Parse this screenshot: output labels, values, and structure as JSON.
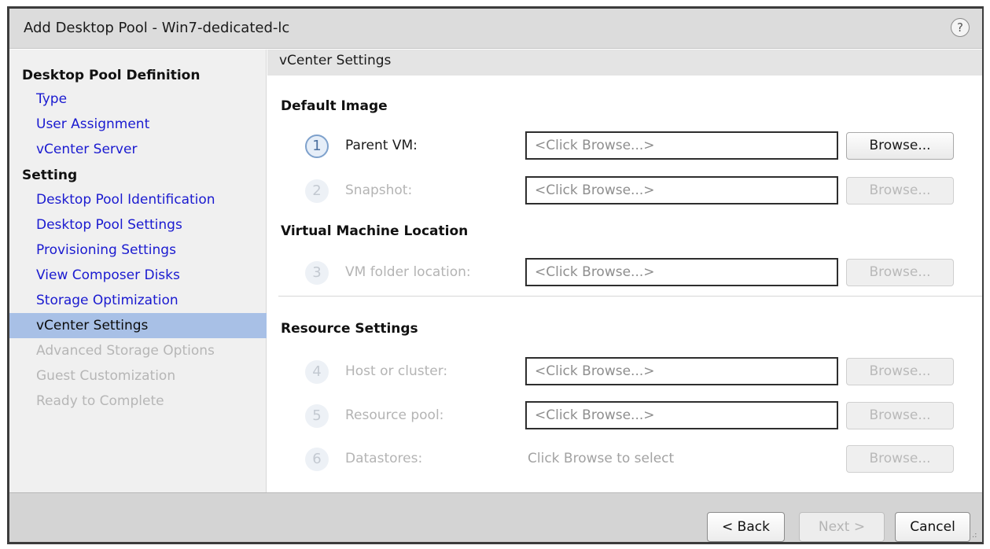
{
  "window": {
    "title": "Add Desktop Pool - Win7-dedicated-lc",
    "help_glyph": "?"
  },
  "sidebar": {
    "sections": [
      {
        "title": "Desktop Pool Definition",
        "items": [
          {
            "label": "Type",
            "state": "link"
          },
          {
            "label": "User Assignment",
            "state": "link"
          },
          {
            "label": "vCenter Server",
            "state": "link"
          }
        ]
      },
      {
        "title": "Setting",
        "items": [
          {
            "label": "Desktop Pool Identification",
            "state": "link"
          },
          {
            "label": "Desktop Pool Settings",
            "state": "link"
          },
          {
            "label": "Provisioning Settings",
            "state": "link"
          },
          {
            "label": "View Composer Disks",
            "state": "link"
          },
          {
            "label": "Storage Optimization",
            "state": "link"
          },
          {
            "label": "vCenter Settings",
            "state": "active"
          },
          {
            "label": "Advanced Storage Options",
            "state": "disabled"
          },
          {
            "label": "Guest Customization",
            "state": "disabled"
          },
          {
            "label": "Ready to Complete",
            "state": "disabled"
          }
        ]
      }
    ]
  },
  "main": {
    "header": "vCenter Settings",
    "groups": [
      {
        "title": "Default Image",
        "rows": [
          {
            "step": "1",
            "label": "Parent VM:",
            "value": "<Click Browse...>",
            "button": "Browse...",
            "enabled": true
          },
          {
            "step": "2",
            "label": "Snapshot:",
            "value": "<Click Browse...>",
            "button": "Browse...",
            "enabled": false
          }
        ]
      },
      {
        "title": "Virtual Machine Location",
        "rows": [
          {
            "step": "3",
            "label": "VM folder location:",
            "value": "<Click Browse...>",
            "button": "Browse...",
            "enabled": false
          }
        ]
      },
      {
        "title": "Resource Settings",
        "rows": [
          {
            "step": "4",
            "label": "Host or cluster:",
            "value": "<Click Browse...>",
            "button": "Browse...",
            "enabled": false
          },
          {
            "step": "5",
            "label": "Resource pool:",
            "value": "<Click Browse...>",
            "button": "Browse...",
            "enabled": false
          },
          {
            "step": "6",
            "label": "Datastores:",
            "value": "Click Browse to select",
            "button": "Browse...",
            "enabled": false
          }
        ]
      }
    ]
  },
  "footer": {
    "back_label": "< Back",
    "next_label": "Next >",
    "next_enabled": false,
    "cancel_label": "Cancel"
  },
  "colors": {
    "link": "#1a1ad0",
    "active_item_bg": "#a8c0e6",
    "disabled_text": "#b4b4b4"
  }
}
